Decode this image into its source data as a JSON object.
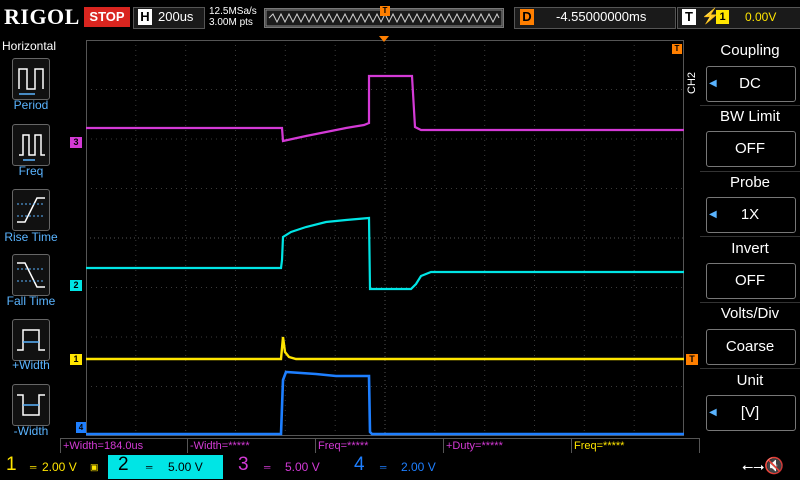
{
  "header": {
    "logo": "RIGOL",
    "run_state": "STOP",
    "horizontal_letter": "H",
    "timebase": "200us",
    "sample_rate": "12.5MSa/s",
    "memory_depth": "3.00M pts",
    "delay_letter": "D",
    "delay": "-4.55000000ms",
    "trigger_letter": "T",
    "trigger_source": "1",
    "trigger_level": "0.00V"
  },
  "left_panel": {
    "title": "Horizontal",
    "items": [
      {
        "label": "Period",
        "icon": "period-icon"
      },
      {
        "label": "Freq",
        "icon": "freq-icon"
      },
      {
        "label": "Rise Time",
        "icon": "rise-time-icon"
      },
      {
        "label": "Fall Time",
        "icon": "fall-time-icon"
      },
      {
        "label": "+Width",
        "icon": "pos-width-icon"
      },
      {
        "label": "-Width",
        "icon": "neg-width-icon"
      }
    ]
  },
  "right_panel": {
    "channel_label": "CH2",
    "items": [
      {
        "title": "Coupling",
        "value": "DC"
      },
      {
        "title": "BW Limit",
        "value": "OFF"
      },
      {
        "title": "Probe",
        "value": "1X"
      },
      {
        "title": "Invert",
        "value": "OFF"
      },
      {
        "title": "Volts/Div",
        "value": "Coarse"
      },
      {
        "title": "Unit",
        "value": "[V]"
      }
    ]
  },
  "channel_markers": {
    "ch3": "3",
    "ch2": "2",
    "ch1": "1",
    "ch4": "4",
    "trigger": "T"
  },
  "measurements": [
    "+Width=184.0us",
    "-Width=*****",
    "Freq=*****",
    "+Duty=*****",
    "Freq=*****"
  ],
  "channels": [
    {
      "num": "1",
      "scale": "2.00 V",
      "color": "#ffe500"
    },
    {
      "num": "2",
      "scale": "5.00 V",
      "color": "#00e5e5"
    },
    {
      "num": "3",
      "scale": "5.00 V",
      "color": "#d43ad6"
    },
    {
      "num": "4",
      "scale": "2.00 V",
      "color": "#1e7fff"
    }
  ],
  "colors": {
    "ch1": "#ffe500",
    "ch2": "#00e5e5",
    "ch3": "#d43ad6",
    "ch4": "#1e7fff",
    "trigger": "#ff7f00",
    "stop": "#d9251f"
  },
  "icons": {
    "usb": "usb-icon",
    "speaker": "speaker-mute-icon"
  }
}
